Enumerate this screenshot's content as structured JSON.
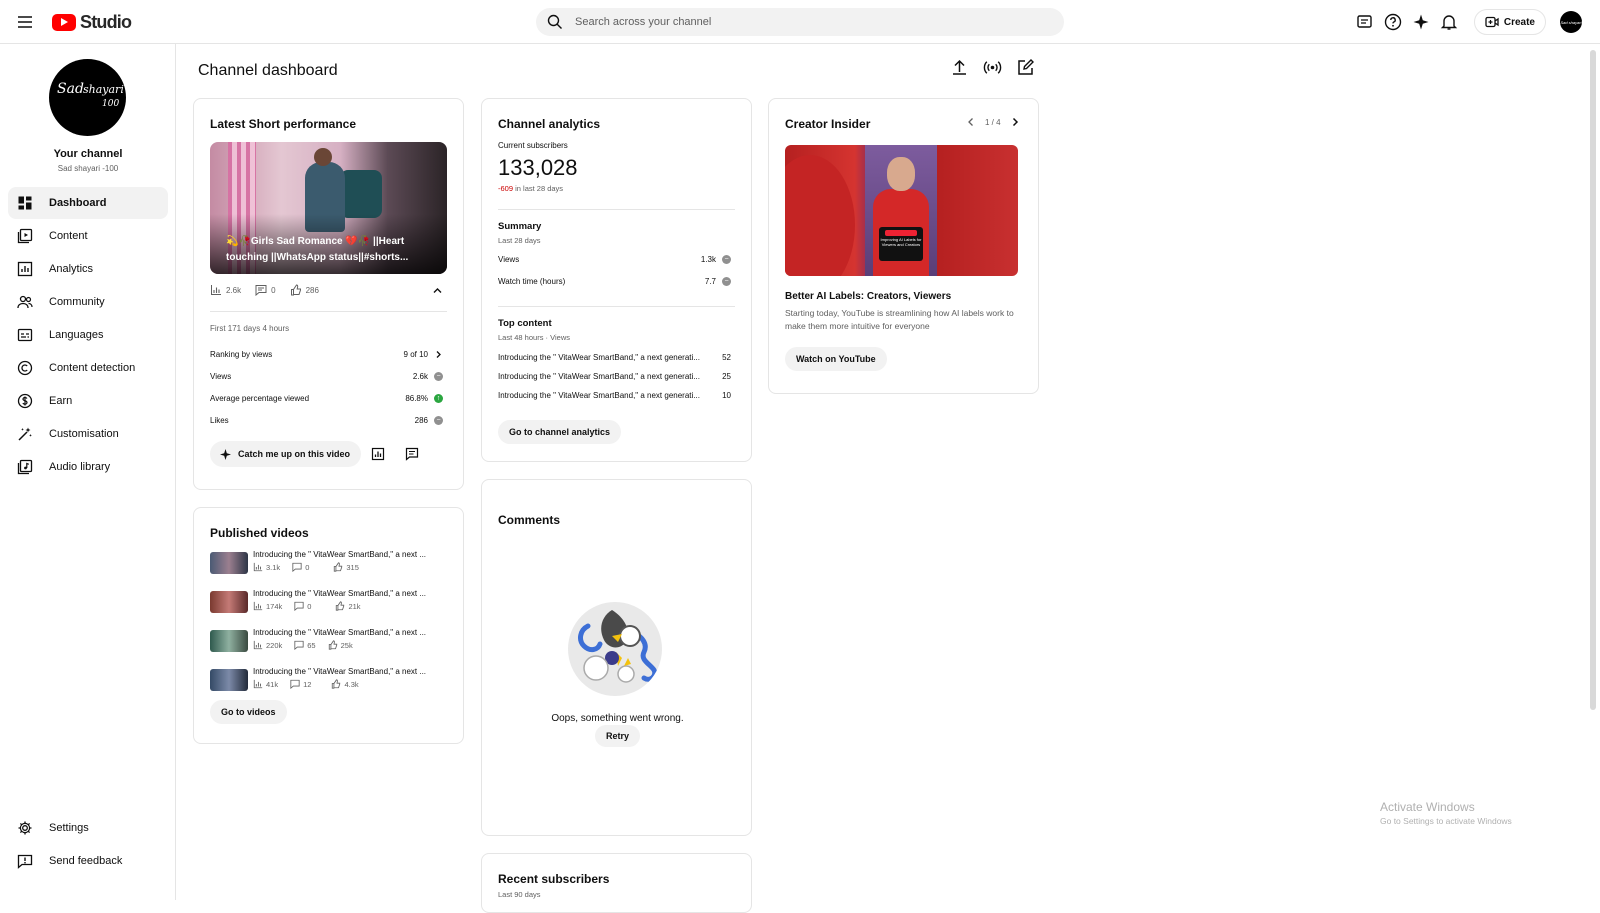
{
  "app": {
    "logo_text": "Studio"
  },
  "search": {
    "placeholder": "Search across your channel"
  },
  "header": {
    "create_label": "Create",
    "avatar_text": "Sad shayari"
  },
  "sidebar": {
    "channel_label": "Your channel",
    "channel_handle": "Sad shayari -100",
    "avatar_line1": "Sad",
    "avatar_line2": "shayari",
    "avatar_line3": "100",
    "items": [
      {
        "label": "Dashboard",
        "icon": "dashboard-icon"
      },
      {
        "label": "Content",
        "icon": "content-icon"
      },
      {
        "label": "Analytics",
        "icon": "analytics-icon"
      },
      {
        "label": "Community",
        "icon": "community-icon"
      },
      {
        "label": "Languages",
        "icon": "languages-icon"
      },
      {
        "label": "Content detection",
        "icon": "copyright-icon"
      },
      {
        "label": "Earn",
        "icon": "earn-icon"
      },
      {
        "label": "Customisation",
        "icon": "customisation-icon"
      },
      {
        "label": "Audio library",
        "icon": "audio-library-icon"
      }
    ],
    "bottom": [
      {
        "label": "Settings",
        "icon": "gear-icon"
      },
      {
        "label": "Send feedback",
        "icon": "feedback-icon"
      }
    ]
  },
  "main": {
    "title": "Channel dashboard"
  },
  "latest_short": {
    "title": "Latest Short performance",
    "thumb_caption": "💫🥀Girls Sad Romance 💔🥀 ||Heart touching ||WhatsApp status||#shorts...",
    "views": "2.6k",
    "comments": "0",
    "likes": "286",
    "first_period": "First 171 days 4 hours",
    "ranking_label": "Ranking by views",
    "ranking_value": "9 of 10",
    "views_label": "Views",
    "views_value": "2.6k",
    "avp_label": "Average percentage viewed",
    "avp_value": "86.8%",
    "likes_label": "Likes",
    "likes_value": "286",
    "catch_up_label": "Catch me up on this video"
  },
  "published": {
    "title": "Published videos",
    "videos": [
      {
        "title": "Introducing the \" VitaWear SmartBand,\" a next ...",
        "views": "3.1k",
        "comments": "0",
        "likes": "315"
      },
      {
        "title": "Introducing the \" VitaWear SmartBand,\" a next ...",
        "views": "174k",
        "comments": "0",
        "likes": "21k"
      },
      {
        "title": "Introducing the \" VitaWear SmartBand,\" a next ...",
        "views": "220k",
        "comments": "65",
        "likes": "25k"
      },
      {
        "title": "Introducing the \" VitaWear SmartBand,\" a next ...",
        "views": "41k",
        "comments": "12",
        "likes": "4.3k"
      }
    ],
    "go_label": "Go to videos"
  },
  "analytics": {
    "title": "Channel analytics",
    "subs_label": "Current subscribers",
    "subs_value": "133,028",
    "subs_change": "-609",
    "subs_period": "in last 28 days",
    "summary_title": "Summary",
    "summary_period": "Last 28 days",
    "views_label": "Views",
    "views_value": "1.3k",
    "watch_label": "Watch time (hours)",
    "watch_value": "7.7",
    "top_title": "Top content",
    "top_period": "Last 48 hours · Views",
    "top_items": [
      {
        "title": "Introducing the \" VitaWear SmartBand,\" a next generati...",
        "value": "52"
      },
      {
        "title": "Introducing the \" VitaWear SmartBand,\" a next generati...",
        "value": "25"
      },
      {
        "title": "Introducing the \" VitaWear SmartBand,\" a next generati...",
        "value": "10"
      }
    ],
    "go_label": "Go to channel analytics"
  },
  "comments": {
    "title": "Comments",
    "error": "Oops, something went wrong.",
    "retry": "Retry"
  },
  "recent_subs": {
    "title": "Recent subscribers",
    "period": "Last 90 days"
  },
  "creator_insider": {
    "title": "Creator Insider",
    "pager": "1 / 4",
    "video_title": "Better AI Labels: Creators, Viewers",
    "description": "Starting today, YouTube is streamlining how AI labels work to make them more intuitive for everyone",
    "watch_label": "Watch on YouTube",
    "thumb_text": "Improving AI Labels for Viewers and Creators",
    "thumb_badge": "Creator Insider"
  },
  "os": {
    "watermark_title": "Activate Windows",
    "watermark_sub": "Go to Settings to activate Windows"
  },
  "colors": {
    "brand_red": "#ff0000",
    "negative": "#cc0000",
    "positive": "#2ba640"
  }
}
